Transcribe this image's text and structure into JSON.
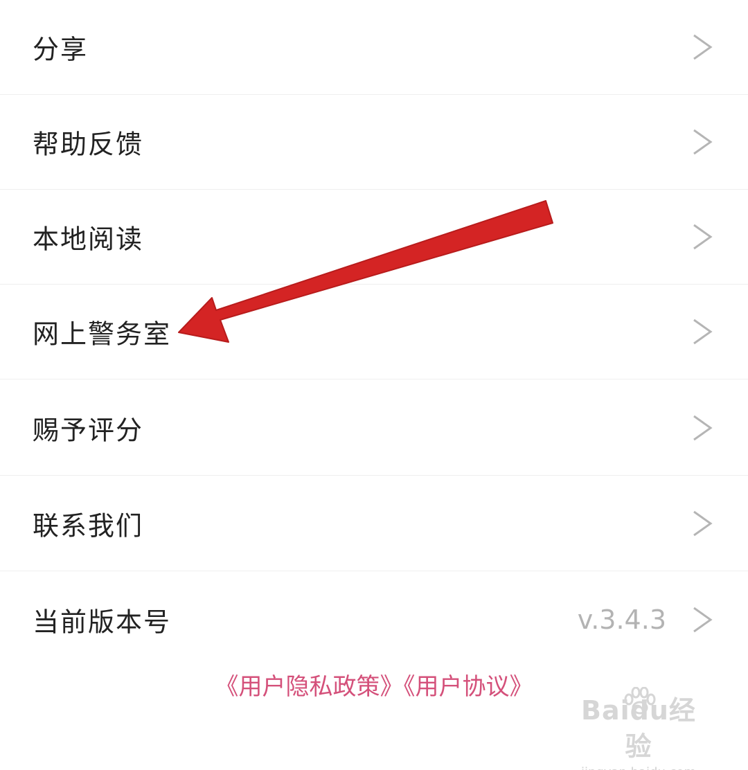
{
  "menu": {
    "items": [
      {
        "label": "分享"
      },
      {
        "label": "帮助反馈"
      },
      {
        "label": "本地阅读"
      },
      {
        "label": "网上警务室"
      },
      {
        "label": "赐予评分"
      },
      {
        "label": "联系我们"
      },
      {
        "label": "当前版本号",
        "value": "v.3.4.3"
      }
    ]
  },
  "footer": {
    "privacy_policy": "《用户隐私政策》",
    "user_agreement": "《用户协议》"
  },
  "watermark": {
    "brand": "Baidu经验",
    "url": "jingyan.baidu.com"
  },
  "annotation": {
    "arrow_color": "#d42424"
  },
  "colors": {
    "link": "#d4507a",
    "label": "#222222",
    "chevron": "#b5b5b5",
    "divider": "#efefef"
  }
}
